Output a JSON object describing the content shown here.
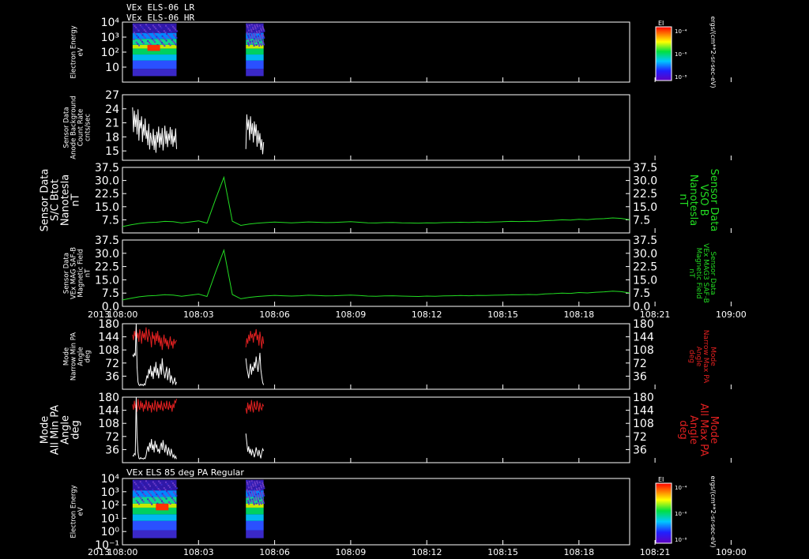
{
  "header": {
    "line1": "VEx ELS-06 LR",
    "line2": "VEx ELS-06 HR"
  },
  "colors": {
    "background": "#000000",
    "axes": "#ffffff",
    "white_trace": "#ffffff",
    "green_trace": "#22dd22",
    "red_trace": "#e02020"
  },
  "x_axis": {
    "ticks": [
      "108:00",
      "108:03",
      "108:06",
      "108:09",
      "108:12",
      "108:15",
      "108:18",
      "108:21",
      "109:00"
    ],
    "year": "2013",
    "range_min": [
      0,
      60
    ],
    "tick_minutes": [
      0,
      9,
      18,
      27,
      36,
      45,
      54,
      63,
      72
    ]
  },
  "chart_data": [
    {
      "id": "p1",
      "type": "heatmap",
      "title": "",
      "ylabel": [
        "Electron Energy",
        "eV"
      ],
      "yticks": [
        "10⁴",
        "10³",
        "10²",
        "10"
      ],
      "ylog": true,
      "ylim": [
        1,
        10000
      ],
      "data_intervals_min": [
        [
          1.2,
          6.4
        ],
        [
          14.6,
          16.7
        ]
      ],
      "colorbar": {
        "label": "EI",
        "ticks": [
          "10⁻⁴",
          "10⁻⁶",
          "10⁻⁸"
        ]
      },
      "units": "ergs/(cm**2-sr-sec-eV)"
    },
    {
      "id": "p2",
      "type": "line",
      "ylabel": [
        "Sensor Data",
        "Anode Background",
        "Count Rate",
        "cnts/sec"
      ],
      "yticks": [
        "27",
        "24",
        "21",
        "18",
        "15"
      ],
      "ylim": [
        13,
        27
      ],
      "series": [
        {
          "color": "white",
          "segments": [
            {
              "x0": 1.2,
              "x1": 6.4,
              "values": [
                24.3,
                19,
                23.6,
                20.1,
                22.8,
                18.5,
                23.9,
                17.2,
                21.6,
                19.8,
                22.4,
                16.9,
                20.7,
                18.3,
                21.9,
                17.6,
                19.4,
                16.2,
                20.8,
                15.3,
                18.9,
                17.4,
                16.1,
                19.7,
                15.2,
                18.4,
                14.6,
                19.1,
                16.8,
                20.2,
                15.7,
                18.8,
                16.3,
                19.9,
                15.1,
                17.6,
                20.4,
                16.5,
                19.3,
                15.8,
                18.7,
                17.2,
                20.1,
                16.4,
                19.6,
                15.9,
                18.2,
                16.8,
                19.8,
                15.4
              ]
            },
            {
              "x0": 14.6,
              "x1": 16.7,
              "values": [
                15.4,
                22.8,
                19.5,
                21.7,
                17.3,
                22.4,
                18.6,
                20.9,
                16.8,
                21.3,
                18.2,
                20.7,
                15.9,
                19.4,
                16.6,
                18.8,
                15.2,
                17.5,
                14.3,
                16.9
              ]
            }
          ]
        }
      ]
    },
    {
      "id": "p3",
      "type": "line",
      "ylabel": [
        "Sensor Data",
        "S/C Btot",
        "Nanotesla",
        "nT"
      ],
      "ylabel_right": [
        "Sensor Data",
        "VSO B",
        "Nanotesla",
        "nT"
      ],
      "yticks": [
        "37.5",
        "30.0",
        "22.5",
        "15.0",
        "7.5"
      ],
      "ylim": [
        0,
        37.5
      ],
      "series": [
        {
          "color": "green",
          "x0": 0,
          "x1": 60,
          "values": [
            3.6,
            4.6,
            5.4,
            5.9,
            6.1,
            6.6,
            6.4,
            5.7,
            6.3,
            6.9,
            5.6,
            19.1,
            31.8,
            6.7,
            4.3,
            5.1,
            5.6,
            5.9,
            6.2,
            6.0,
            5.8,
            6.0,
            6.3,
            6.1,
            5.9,
            6.0,
            6.2,
            6.4,
            6.1,
            5.8,
            5.7,
            5.9,
            6.0,
            5.8,
            5.7,
            5.6,
            5.8,
            5.7,
            5.9,
            6.0,
            6.1,
            6.0,
            6.2,
            6.1,
            6.3,
            6.4,
            6.6,
            6.5,
            6.7,
            6.6,
            7.0,
            7.2,
            7.5,
            7.3,
            7.8,
            7.6,
            8.0,
            8.2,
            8.6,
            8.3,
            7.6
          ]
        }
      ]
    },
    {
      "id": "p4",
      "type": "line",
      "ylabel": [
        "Sensor Data",
        "VEx MAG SAF-B",
        "Magnetic Field",
        "nT"
      ],
      "ylabel_right": [
        "Sensor Data",
        "VEx MAG3 SAF-B",
        "Magnetic Field",
        "nT"
      ],
      "yticks": [
        "37.5",
        "30.0",
        "22.5",
        "15.0",
        "7.5",
        "0.0"
      ],
      "ylim": [
        0,
        37.5
      ],
      "series": [
        {
          "color": "green",
          "x0": 0,
          "x1": 60,
          "values": [
            3.6,
            4.6,
            5.4,
            5.9,
            6.1,
            6.6,
            6.4,
            5.7,
            6.3,
            6.9,
            5.6,
            19.1,
            31.8,
            6.7,
            4.3,
            5.1,
            5.6,
            5.9,
            6.2,
            6.0,
            5.8,
            6.0,
            6.3,
            6.1,
            5.9,
            6.0,
            6.2,
            6.4,
            6.1,
            5.8,
            5.7,
            5.9,
            6.0,
            5.8,
            5.7,
            5.6,
            5.8,
            5.7,
            5.9,
            6.0,
            6.1,
            6.0,
            6.2,
            6.1,
            6.3,
            6.4,
            6.6,
            6.5,
            6.7,
            6.6,
            7.0,
            7.2,
            7.5,
            7.3,
            7.8,
            7.6,
            8.0,
            8.2,
            8.6,
            8.3,
            7.6
          ]
        }
      ]
    },
    {
      "id": "p5",
      "type": "line",
      "ylabel": [
        "Mode",
        "Narrow Min PA",
        "Angle",
        "deg"
      ],
      "ylabel_right": [
        "Mode",
        "Narrow Max PA",
        "Angle",
        "deg"
      ],
      "yticks": [
        "180",
        "144",
        "108",
        "72",
        "36"
      ],
      "ylim": [
        0,
        180
      ],
      "series": [
        {
          "color": "red",
          "segments": [
            {
              "x0": 1.2,
              "x1": 6.4,
              "values": [
                150,
                135,
                160,
                145,
                170,
                140,
                155,
                130,
                165,
                150,
                125,
                160,
                140,
                155,
                135,
                170,
                145,
                130,
                165,
                150,
                140,
                115,
                158,
                138,
                148,
                122,
                155,
                132,
                160,
                128,
                148,
                118,
                142,
                108,
                130,
                150,
                125,
                140,
                118,
                135,
                110,
                128,
                145,
                120,
                132,
                112,
                138,
                125,
                130,
                135
              ]
            },
            {
              "x0": 14.6,
              "x1": 16.7,
              "values": [
                115,
                140,
                125,
                150,
                132,
                160,
                140,
                152,
                128,
                155,
                145,
                165,
                135,
                150,
                120,
                158,
                138,
                112,
                145,
                125
              ]
            }
          ]
        },
        {
          "color": "white",
          "segments": [
            {
              "x0": 1.2,
              "x1": 6.4,
              "values": [
                95,
                90,
                98,
                92,
                180,
                60,
                20,
                12,
                10,
                14,
                11,
                13,
                10,
                15,
                12,
                25,
                38,
                30,
                55,
                42,
                65,
                35,
                50,
                28,
                62,
                45,
                75,
                38,
                58,
                30,
                48,
                70,
                40,
                85,
                55,
                45,
                30,
                48,
                62,
                25,
                42,
                58,
                18,
                38,
                28,
                15,
                22,
                32,
                12,
                20
              ]
            },
            {
              "x0": 14.6,
              "x1": 16.7,
              "values": [
                85,
                60,
                45,
                30,
                55,
                70,
                40,
                62,
                50,
                75,
                58,
                90,
                65,
                48,
                72,
                100,
                55,
                35,
                18,
                12
              ]
            }
          ]
        }
      ]
    },
    {
      "id": "p6",
      "type": "line",
      "ylabel": [
        "Mode",
        "All Min PA",
        "Angle",
        "deg"
      ],
      "ylabel_right": [
        "Mode",
        "All Max PA",
        "Angle",
        "deg"
      ],
      "yticks": [
        "180",
        "144",
        "108",
        "72",
        "36"
      ],
      "ylim": [
        0,
        180
      ],
      "series": [
        {
          "color": "red",
          "segments": [
            {
              "x0": 1.2,
              "x1": 6.4,
              "values": [
                160,
                145,
                170,
                150,
                165,
                140,
                175,
                155,
                145,
                170,
                150,
                165,
                140,
                160,
                148,
                172,
                155,
                142,
                168,
                150,
                158,
                138,
                165,
                150,
                145,
                172,
                155,
                140,
                168,
                150,
                160,
                145,
                170,
                150,
                142,
                165,
                155,
                148,
                170,
                152,
                145,
                168,
                150,
                158,
                140,
                162,
                150,
                170,
                165,
                175
              ]
            },
            {
              "x0": 14.6,
              "x1": 16.7,
              "values": [
                150,
                135,
                165,
                145,
                160,
                140,
                172,
                150,
                138,
                168,
                152,
                145,
                170,
                155,
                140,
                165,
                150,
                145,
                160,
                155
              ]
            }
          ]
        },
        {
          "color": "white",
          "segments": [
            {
              "x0": 1.2,
              "x1": 6.4,
              "values": [
                20,
                18,
                25,
                22,
                180,
                70,
                28,
                12,
                10,
                14,
                11,
                12,
                10,
                13,
                11,
                20,
                35,
                45,
                30,
                55,
                40,
                65,
                35,
                50,
                28,
                60,
                42,
                48,
                30,
                38,
                25,
                45,
                55,
                35,
                62,
                40,
                28,
                50,
                35,
                20,
                42,
                30,
                18,
                38,
                25,
                15,
                22,
                12,
                18,
                10
              ]
            },
            {
              "x0": 14.6,
              "x1": 16.7,
              "values": [
                80,
                55,
                30,
                45,
                25,
                38,
                20,
                35,
                28,
                15,
                25,
                42,
                30,
                18,
                35,
                22,
                12,
                28,
                38,
                32
              ]
            }
          ]
        }
      ]
    },
    {
      "id": "p7",
      "type": "heatmap",
      "title": "VEx ELS 85 deg PA Regular",
      "ylabel": [
        "Electron Energy",
        "eV"
      ],
      "yticks": [
        "10⁴",
        "10³",
        "10²",
        "10¹",
        "10⁰",
        "10⁻¹"
      ],
      "ylog": true,
      "ylim": [
        0.1,
        10000
      ],
      "data_intervals_min": [
        [
          1.2,
          6.4
        ],
        [
          14.6,
          16.7
        ]
      ],
      "colorbar": {
        "label": "EI",
        "ticks": [
          "10⁻⁴",
          "10⁻⁶",
          "10⁻⁸"
        ]
      },
      "units": "ergs/(cm**2-sr-sec-eV)"
    }
  ]
}
